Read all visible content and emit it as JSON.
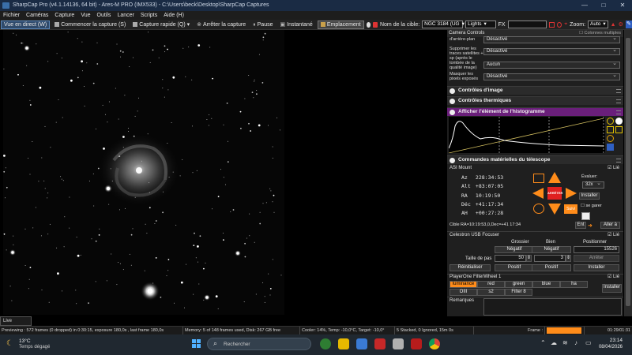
{
  "window": {
    "title": "SharpCap Pro (v4.1.14136, 64 bit) - Ares-M PRO (IMX533) - C:\\Users\\beck\\Desktop\\SharpCap Captures",
    "controls": [
      "—",
      "□",
      "✕"
    ]
  },
  "menu": [
    "Fichier",
    "Caméras",
    "Capture",
    "Vue",
    "Outils",
    "Lancer",
    "Scripts",
    "Aide (H)"
  ],
  "toolbar": {
    "live": "Vue en direct (W)",
    "start_capture": "Commencer la capture (S)",
    "quick_capture": "Capture rapide (Q)",
    "stop_capture": "Arrêter la capture",
    "pause": "Pause",
    "snapshot": "Instantané",
    "location": "Emplacement",
    "target_label": "Nom de la cible:",
    "target_value": "NGC 3184 (UG",
    "frame_type": "Lights",
    "fx_label": "FX",
    "zoom_label": "Zoom:",
    "zoom_value": "Auto"
  },
  "panel": {
    "camera_controls": "Camera Controls",
    "multi_columns": "Colonnes multiples",
    "bg_subtraction_label": "d'arrière-plan",
    "bg_subtraction_value": "Désactivé",
    "remove_trails_label": "Supprimer les traces satellites + sp (après le tombée de la qualité image)",
    "remove_trails_value": "Désactivé",
    "row3_value": "Aucun",
    "mask_pixels_label": "Masquer les pixels exposés",
    "mask_pixels_value": "Désactivé",
    "image_controls": "Contrôles d'image",
    "thermal_controls": "Contrôles thermiques",
    "histogram": "Afficher l'élément de l'histogramme",
    "telescope": "Commandes matérielles du télescope",
    "mount": {
      "name": "ASI Mount",
      "linked": "Lié",
      "az_label": "Az",
      "az": "228:34:53",
      "alt_label": "Alt",
      "alt": "+83:07:05",
      "ra_label": "RA",
      "ra": "10:19:50",
      "dec_label": "Déc",
      "dec": "+41:17:34",
      "ah_label": "AH",
      "ah": "+00:27:28",
      "rate_label": "Évaluer:",
      "rate_value": "32x",
      "install": "Installer",
      "park": "se garer",
      "stop": "ARRÊTER",
      "follow": "Suivi",
      "target_line": "Cible  RA=10:19:53,0,Dec=+41 17:34",
      "goto": "Aller à",
      "enter": "Ent"
    },
    "focuser": {
      "name": "Celestron USB Focuser",
      "linked": "Lié",
      "coarse": "Grossier",
      "fine": "Bien",
      "position": "Positionner",
      "negative": "Négatif",
      "position_value": "15526",
      "step_label": "Taille de pas",
      "coarse_step": "50",
      "fine_step": "3",
      "stop": "Arrêter",
      "reset": "Réinitialiser",
      "positive": "Positif",
      "install": "Installer"
    },
    "filterwheel": {
      "name": "PlayerOne FilterWheel 1",
      "linked": "Lié",
      "filters": [
        "luminance",
        "red",
        "green",
        "blue",
        "ha",
        "OIII",
        "s2",
        "Filter 8"
      ],
      "install": "Installer"
    },
    "remarks": "Remarques"
  },
  "live_stacking": "Live Stacking",
  "status": {
    "previewing": "Previewing : 572 frames (0 dropped) in 0:30:15, exposure 180,0s , last frame 180,0s",
    "memory": "Memory: 5 of 148 frames used, Disk: 267 GB free",
    "cooler": "Cooler: 14%, Temp: -10,0°C, Target: -10,0°",
    "stacked": "5 Stacked, 0 Ignored, 15m 0s",
    "frame_label": "Frame :",
    "clock": "01:29/01:31"
  },
  "taskbar": {
    "weather_temp": "13°C",
    "weather_text": "Temps dégagé",
    "search_placeholder": "Rechercher",
    "time": "23:14",
    "date": "08/04/2026"
  },
  "colors": {
    "title_bg": "#1a2b44",
    "purple_header": "#6a1f7a",
    "arrow_orange": "#ff8c1a",
    "stop_red": "#e02020",
    "frame_progress": "#ff8c1a"
  }
}
